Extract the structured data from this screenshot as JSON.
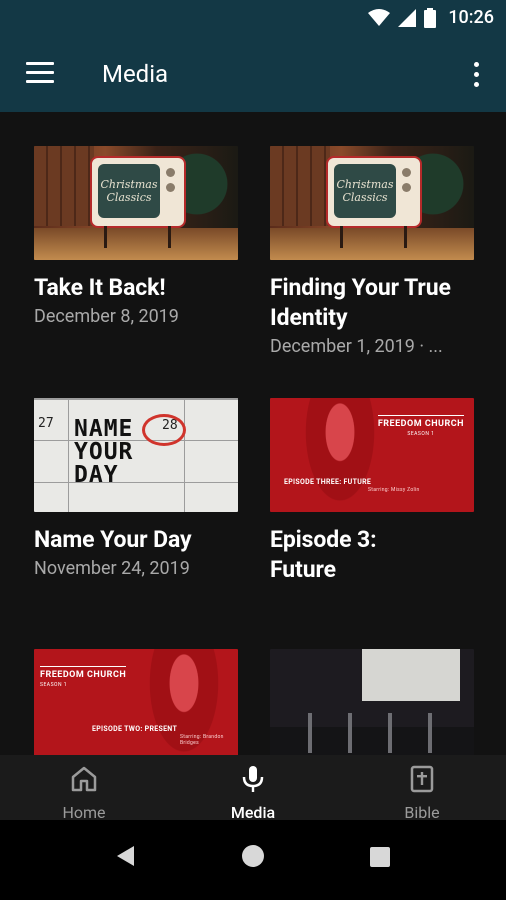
{
  "status": {
    "time": "10:26",
    "wifi_icon": "wifi-icon",
    "signal_icon": "cell-signal-icon",
    "battery_icon": "battery-icon"
  },
  "appbar": {
    "title": "Media",
    "menu_icon": "hamburger-menu-icon",
    "more_icon": "more-vert-icon"
  },
  "media": [
    {
      "title": "Take It Back!",
      "subtitle": "December 8, 2019",
      "thumbnail": "Christmas Classics TV"
    },
    {
      "title": "Finding Your True Identity",
      "subtitle": "December 1, 2019 · ...",
      "thumbnail": "Christmas Classics TV"
    },
    {
      "title": "Name Your Day",
      "subtitle": "November 24, 2019",
      "thumbnail": "Name Your Day calendar"
    },
    {
      "title": "Episode 3: Future",
      "subtitle": "",
      "thumbnail": "Freedom Church Episode Three"
    },
    {
      "title": "",
      "subtitle": "",
      "thumbnail": "Freedom Church Episode Two"
    },
    {
      "title": "",
      "subtitle": "",
      "thumbnail": "Stage band"
    }
  ],
  "thumb_text": {
    "tv_line1": "Christmas",
    "tv_line2": "Classics",
    "cal_num_left": "27",
    "cal_num_right": "28",
    "cal_hand": "NAME\nYOUR\nDAY",
    "fc_brand": "FREEDOM CHURCH",
    "fc_sub": "SEASON 1",
    "fc_ep3": "EPISODE THREE: FUTURE",
    "fc_ep3_starring": "Starring: Missy Zolin",
    "fc_ep2": "EPISODE TWO: PRESENT",
    "fc_ep2_starring": "Starring: Brandon Bridges"
  },
  "bottom_nav": [
    {
      "label": "Home",
      "icon": "home-icon",
      "active": false
    },
    {
      "label": "Media",
      "icon": "microphone-icon",
      "active": true
    },
    {
      "label": "Bible",
      "icon": "bible-icon",
      "active": false
    }
  ],
  "system_nav": {
    "back": "back-icon",
    "home": "home-circle-icon",
    "recents": "recents-square-icon"
  },
  "colors": {
    "appbar": "#133845",
    "background": "#121212",
    "nav_bg": "#1b1b1b",
    "muted_text": "#a9a9a9",
    "accent_red": "#b3151b"
  }
}
